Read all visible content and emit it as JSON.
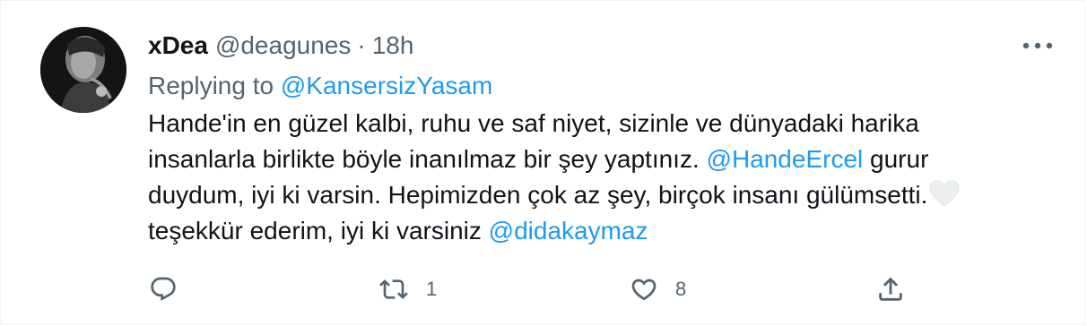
{
  "tweet": {
    "display_name": "xDea",
    "handle": "@deagunes",
    "separator": "·",
    "time": "18h",
    "replying_prefix": "Replying to ",
    "replying_to": "@KansersizYasam",
    "lines": [
      [
        "Hande'in en güzel kalbi, ruhu ve saf niyet, sizinle ve dünyadaki harika"
      ],
      [
        "insanlarla birlikte böyle inanılmaz bir şey yaptınız. ",
        "@HandeErcel",
        " gurur"
      ],
      [
        "duydum, iyi ki varsin. Hepimizden çok az şey, birçok insanı gülümsetti."
      ],
      [
        "teşekkür ederim, iyi ki varsiniz ",
        "@didakaymaz"
      ]
    ],
    "line1": "Hande'in en güzel kalbi, ruhu ve saf niyet, sizinle ve dünyadaki harika",
    "line2_text": "insanlarla birlikte böyle inanılmaz bir şey yaptınız. ",
    "line2_mention": "@HandeErcel",
    "line2_tail": " gurur",
    "line3": "duydum, iyi ki varsin. Hepimizden çok az şey, birçok insanı gülümsetti.",
    "line3_emoji": "white-heart-icon",
    "line4_text": "teşekkür ederim, iyi ki varsiniz ",
    "line4_mention": "@didakaymaz"
  },
  "actions": {
    "reply_icon": "reply-icon",
    "retweet_icon": "retweet-icon",
    "retweet_count": "1",
    "like_icon": "heart-icon",
    "like_count": "8",
    "share_icon": "share-icon"
  },
  "colors": {
    "text": "#0f1419",
    "secondary": "#536471",
    "link": "#1d9bf0",
    "border": "#eff3f4"
  }
}
